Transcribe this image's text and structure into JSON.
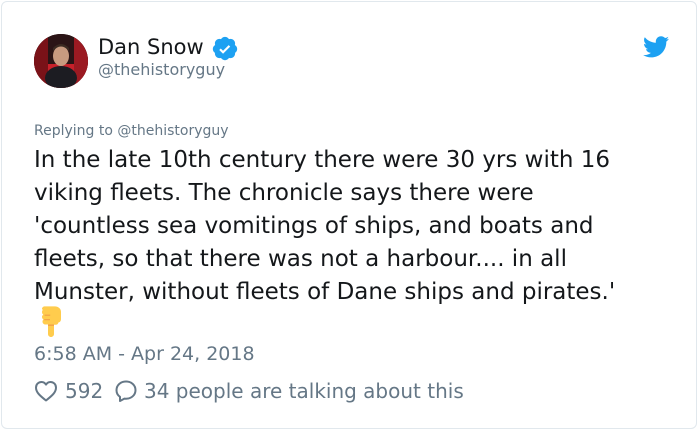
{
  "author": {
    "name": "Dan Snow",
    "handle": "@thehistoryguy",
    "verified": true
  },
  "reply": {
    "prefix": "Replying to ",
    "handle": "@thehistoryguy"
  },
  "tweet": {
    "lines": [
      "In the late 10th century there were 30 yrs with 16",
      "viking fleets. The chronicle says there were",
      "'countless sea vomitings of ships, and boats and",
      "fleets, so that there was not a harbour.... in all",
      "Munster, without fleets of Dane ships and pirates.'"
    ],
    "emoji": "backhand-index-pointing-down"
  },
  "timestamp": "6:58 AM - Apr 24, 2018",
  "stats": {
    "likes": "592",
    "talking": "34 people are talking about this"
  },
  "colors": {
    "text": "#14171a",
    "secondary": "#657786",
    "brand_blue": "#1da1f2",
    "border": "#e1e8ed"
  },
  "icons": {
    "verified": "verified-badge-icon",
    "platform": "twitter-bird-icon",
    "like": "heart-outline-icon",
    "reply": "speech-bubble-icon"
  }
}
